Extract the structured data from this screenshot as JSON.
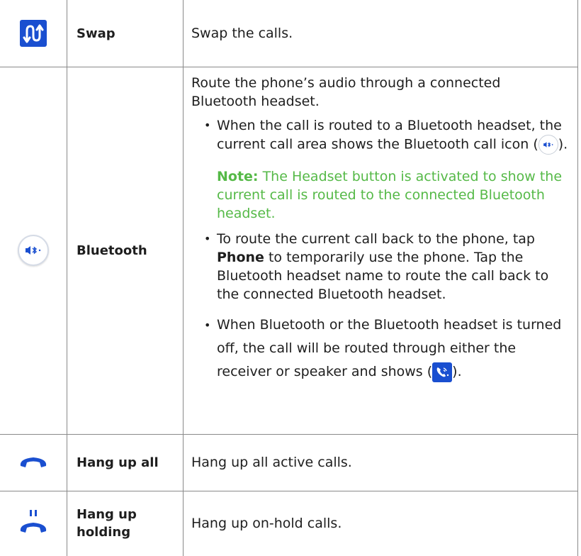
{
  "rows": [
    {
      "icon": "swap-arrows-icon",
      "name": "Swap",
      "description": "Swap the calls."
    },
    {
      "icon": "bluetooth-audio-icon",
      "name": "Bluetooth",
      "intro": "Route the phone’s audio through a connected Bluetooth headset.",
      "bullet1": {
        "text_before": "When the call is routed to a Bluetooth headset, the current call area shows the Bluetooth call icon (",
        "icon": "bluetooth-call-icon",
        "text_after": ")."
      },
      "note": {
        "label": "Note:",
        "text": " The Headset button is activated to show the current call is routed to the connected Bluetooth headset."
      },
      "bullet2": {
        "text_before": "To route the current call back to the phone, tap ",
        "bold": "Phone",
        "text_after": " to temporarily use the phone. Tap the Bluetooth headset name to route the call back to the connected Bluetooth headset."
      },
      "bullet3": {
        "text_before": "When Bluetooth or the Bluetooth headset is turned off, the call will be routed through either the receiver or speaker and shows (",
        "icon": "handset-speaker-icon",
        "text_after": ")."
      }
    },
    {
      "icon": "hang-up-icon",
      "name": "Hang up all",
      "description": "Hang up all active calls."
    },
    {
      "icon": "hang-up-holding-icon",
      "name": "Hang up holding",
      "description": "Hang up on-hold calls."
    }
  ],
  "colors": {
    "accent_blue": "#1a4fd0",
    "note_green": "#55b947",
    "grid": "#8a8a8a"
  }
}
